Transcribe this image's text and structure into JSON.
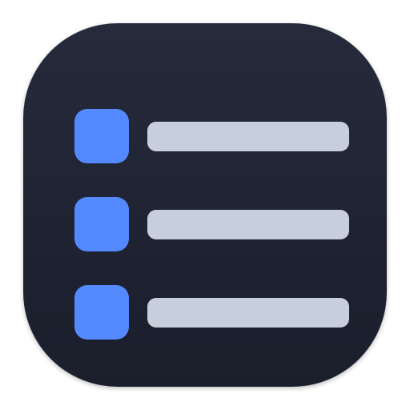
{
  "icon": {
    "name": "list-app-icon",
    "colors": {
      "background_top": "#262b3c",
      "background_bottom": "#1b1f2c",
      "bullet": "#5589ff",
      "bar": "#c8cfdc"
    },
    "items": [
      {
        "bullet_icon": "square-bullet-icon",
        "line_icon": "text-line-icon"
      },
      {
        "bullet_icon": "square-bullet-icon",
        "line_icon": "text-line-icon"
      },
      {
        "bullet_icon": "square-bullet-icon",
        "line_icon": "text-line-icon"
      }
    ]
  }
}
